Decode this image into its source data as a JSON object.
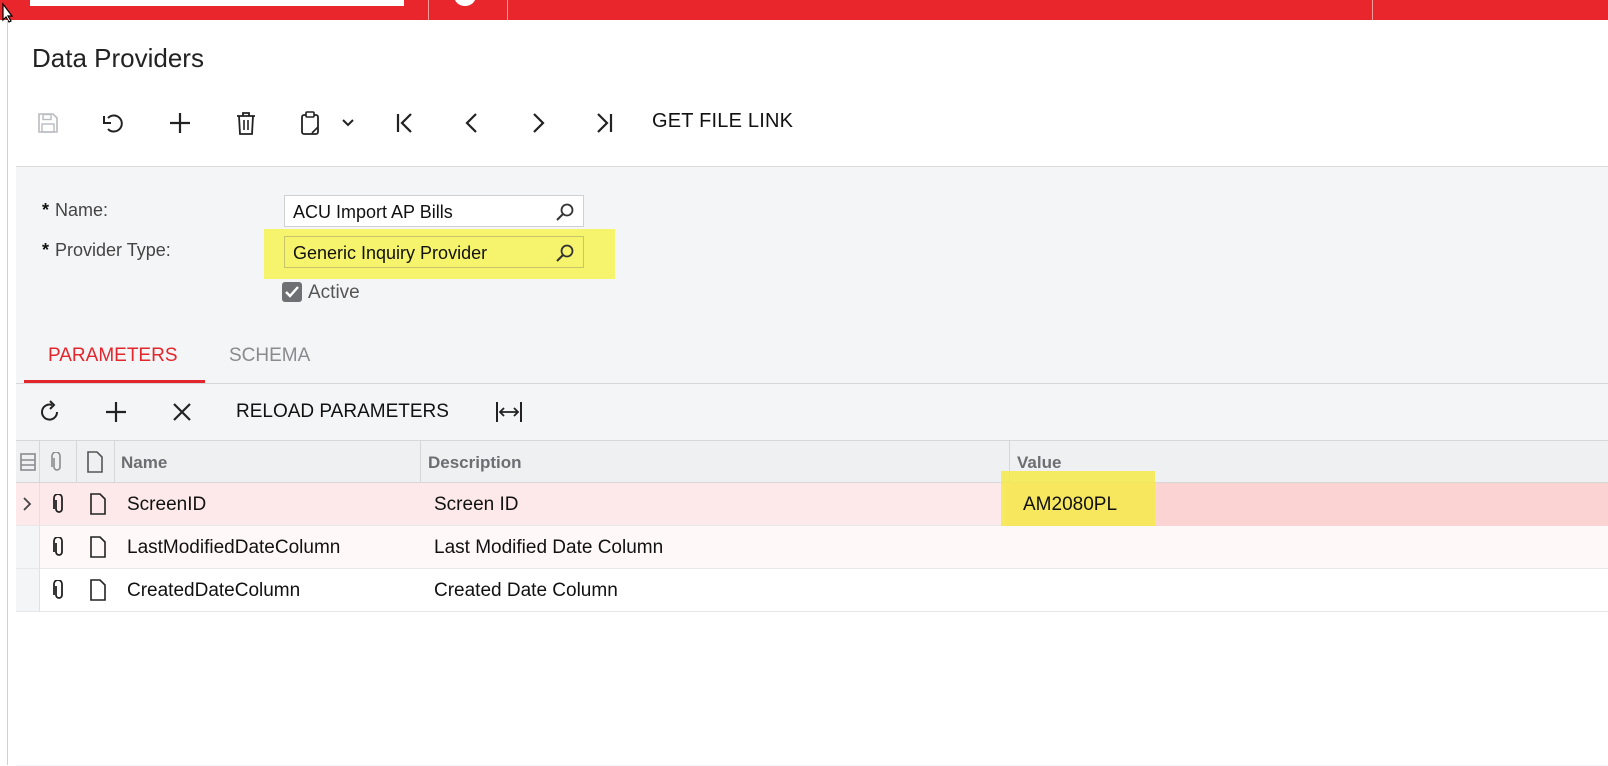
{
  "page": {
    "title": "Data Providers"
  },
  "toolbar": {
    "get_file_link": "GET FILE LINK"
  },
  "form": {
    "name_label": "Name:",
    "name_value": "ACU Import AP Bills",
    "provider_type_label": "Provider Type:",
    "provider_type_value": "Generic Inquiry Provider",
    "required_mark": "*",
    "active_label": "Active",
    "active_checked": true
  },
  "tabs": [
    {
      "label": "PARAMETERS",
      "active": true
    },
    {
      "label": "SCHEMA",
      "active": false
    }
  ],
  "grid_toolbar": {
    "reload_parameters": "RELOAD PARAMETERS"
  },
  "grid": {
    "columns": [
      "Name",
      "Description",
      "Value"
    ],
    "rows": [
      {
        "name": "ScreenID",
        "description": "Screen ID",
        "value": "AM2080PL"
      },
      {
        "name": "LastModifiedDateColumn",
        "description": "Last Modified Date Column",
        "value": ""
      },
      {
        "name": "CreatedDateColumn",
        "description": "Created Date Column",
        "value": ""
      }
    ]
  },
  "colors": {
    "brand_red": "#e8262b",
    "highlight_yellow": "#f6f254",
    "selected_row": "#fde9e9",
    "active_tab": "#e3262b"
  }
}
